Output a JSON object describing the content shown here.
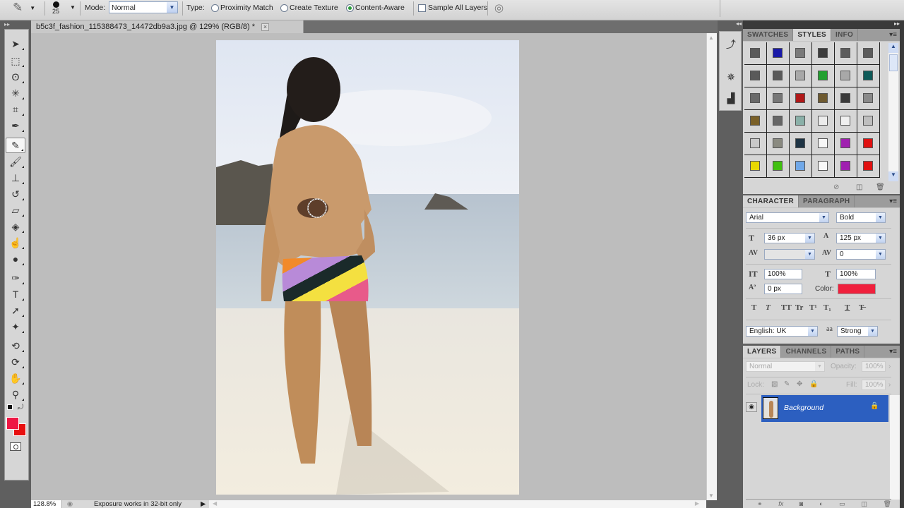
{
  "options_bar": {
    "tool_icon": "spot-healing-brush-icon",
    "brush_size": "25",
    "mode_label": "Mode:",
    "mode_value": "Normal",
    "type_label": "Type:",
    "type_options": [
      {
        "label": "Proximity Match",
        "selected": false
      },
      {
        "label": "Create Texture",
        "selected": false
      },
      {
        "label": "Content-Aware",
        "selected": true
      }
    ],
    "sample_all_layers_label": "Sample All Layers",
    "sample_all_layers_checked": false,
    "pressure_icon": "tablet-pressure-icon"
  },
  "document": {
    "tab_title": "b5c3f_fashion_115388473_14472db9a3.jpg @ 129% (RGB/8) *",
    "close_label": "×",
    "zoom_status": "128.8%",
    "status_message": "Exposure works in 32-bit only"
  },
  "toolbox": {
    "tools": [
      {
        "name": "move-tool",
        "glyph": "➤"
      },
      {
        "name": "marquee-tool",
        "glyph": "⬚"
      },
      {
        "name": "lasso-tool",
        "glyph": "ʘ"
      },
      {
        "name": "magic-wand-tool",
        "glyph": "✳"
      },
      {
        "name": "crop-tool",
        "glyph": "⌗"
      },
      {
        "name": "eyedropper-tool",
        "glyph": "✒"
      },
      {
        "name": "spot-healing-brush-tool",
        "glyph": "✎",
        "active": true
      },
      {
        "name": "brush-tool",
        "glyph": "🖌"
      },
      {
        "name": "clone-stamp-tool",
        "glyph": "⊥"
      },
      {
        "name": "history-brush-tool",
        "glyph": "↺"
      },
      {
        "name": "eraser-tool",
        "glyph": "▱"
      },
      {
        "name": "paint-bucket-tool",
        "glyph": "◈"
      },
      {
        "name": "blur-tool",
        "glyph": "☝"
      },
      {
        "name": "dodge-tool",
        "glyph": "●"
      },
      {
        "name": "pen-tool",
        "glyph": "✑"
      },
      {
        "name": "type-tool",
        "glyph": "T"
      },
      {
        "name": "path-selection-tool",
        "glyph": "➚"
      },
      {
        "name": "shape-tool",
        "glyph": "✦"
      },
      {
        "name": "3d-rotate-tool",
        "glyph": "⟲"
      },
      {
        "name": "3d-orbit-tool",
        "glyph": "⟳"
      },
      {
        "name": "hand-tool",
        "glyph": "✋"
      },
      {
        "name": "zoom-tool",
        "glyph": "⚲"
      }
    ],
    "foreground_color": "#ee1744",
    "background_color": "#e81010"
  },
  "styles_panel": {
    "tabs": [
      "SWATCHES",
      "STYLES",
      "INFO"
    ],
    "active_tab": "STYLES",
    "swatches": [
      "#5a5a5a",
      "#1a1aa8",
      "#7a7a7a",
      "#3c3c3c",
      "#5c5c5c",
      "#5c5c5c",
      "#5a5a5a",
      "#5a5a5a",
      "#a8a8a8",
      "#22a030",
      "#a8a8a8",
      "#0e5a58",
      "#6a6a6a",
      "#777777",
      "#b01818",
      "#6e5a30",
      "#3a3a3a",
      "#8a8a8a",
      "#7a6028",
      "#666666",
      "#8ab0a8",
      "#ececec",
      "#f0f0f0",
      "#bebebe",
      "#c8c8c8",
      "#8a8a80",
      "#1e3444",
      "#f6f6f6",
      "#a020b0",
      "#e01010",
      "#e8d800",
      "#40c010",
      "#70a8e8",
      "#f8f8f8",
      "#a020b0",
      "#e01010"
    ]
  },
  "character_panel": {
    "tabs": [
      "CHARACTER",
      "PARAGRAPH"
    ],
    "active_tab": "CHARACTER",
    "font_family": "Arial",
    "font_style": "Bold",
    "font_size": "36 px",
    "leading": "125 px",
    "kerning": "",
    "tracking": "0",
    "vertical_scale": "100%",
    "horizontal_scale": "100%",
    "baseline_shift": "0 px",
    "color_label": "Color:",
    "color_value": "#f0203c",
    "style_buttons": [
      "T",
      "T",
      "TT",
      "Tr",
      "T¹",
      "T₁",
      "T",
      "T̶"
    ],
    "language": "English: UK",
    "antialias": "Strong",
    "antialias_icon": "aa"
  },
  "layers_panel": {
    "tabs": [
      "LAYERS",
      "CHANNELS",
      "PATHS"
    ],
    "active_tab": "LAYERS",
    "blend_mode": "Normal",
    "opacity_label": "Opacity:",
    "opacity_value": "100%",
    "lock_label": "Lock:",
    "fill_label": "Fill:",
    "fill_value": "100%",
    "layers": [
      {
        "name": "Background",
        "visible": true,
        "locked": true,
        "selected": true
      }
    ]
  }
}
